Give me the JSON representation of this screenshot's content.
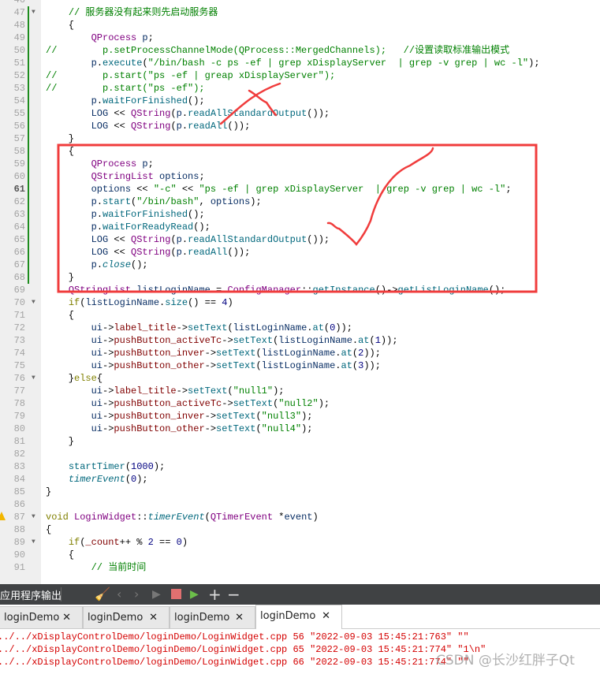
{
  "editor": {
    "current_line": "61",
    "lines": [
      {
        "n": "46",
        "tokens": []
      },
      {
        "n": "47",
        "fold": true,
        "bar": true,
        "tokens": [
          [
            "    ",
            "p"
          ],
          [
            "// 服务器没有起来则先启动服务器",
            "c"
          ]
        ]
      },
      {
        "n": "48",
        "bar": true,
        "tokens": [
          [
            "    {",
            "p"
          ]
        ]
      },
      {
        "n": "49",
        "bar": true,
        "tokens": [
          [
            "        ",
            "p"
          ],
          [
            "QProcess",
            "t"
          ],
          [
            " p",
            "v"
          ],
          [
            ";",
            "p"
          ]
        ]
      },
      {
        "n": "50",
        "bar": true,
        "tokens": [
          [
            "//        p.setProcessChannelMode(QProcess::MergedChannels);   //设置读取标准输出模式",
            "c"
          ]
        ]
      },
      {
        "n": "51",
        "bar": true,
        "tokens": [
          [
            "        p",
            "v"
          ],
          [
            ".",
            "p"
          ],
          [
            "execute",
            "f"
          ],
          [
            "(",
            "p"
          ],
          [
            "\"/bin/bash -c ps -ef | grep xDisplayServer  | grep -v grep | wc -l\"",
            "s"
          ],
          [
            ");",
            "p"
          ]
        ]
      },
      {
        "n": "52",
        "bar": true,
        "tokens": [
          [
            "//        p.start(\"ps -ef | greap xDisplayServer\");",
            "c"
          ]
        ]
      },
      {
        "n": "53",
        "bar": true,
        "tokens": [
          [
            "//        p.start(\"ps -ef\");",
            "c"
          ]
        ]
      },
      {
        "n": "54",
        "bar": true,
        "tokens": [
          [
            "        p",
            "v"
          ],
          [
            ".",
            "p"
          ],
          [
            "waitForFinished",
            "f"
          ],
          [
            "();",
            "p"
          ]
        ]
      },
      {
        "n": "55",
        "bar": true,
        "tokens": [
          [
            "        LOG",
            "v"
          ],
          [
            " << ",
            "p"
          ],
          [
            "QString",
            "t"
          ],
          [
            "(",
            "p"
          ],
          [
            "p",
            "v"
          ],
          [
            ".",
            "p"
          ],
          [
            "readAllStandardOutput",
            "f"
          ],
          [
            "());",
            "p"
          ]
        ]
      },
      {
        "n": "56",
        "bar": true,
        "tokens": [
          [
            "        LOG",
            "v"
          ],
          [
            " << ",
            "p"
          ],
          [
            "QString",
            "t"
          ],
          [
            "(",
            "p"
          ],
          [
            "p",
            "v"
          ],
          [
            ".",
            "p"
          ],
          [
            "readAll",
            "f"
          ],
          [
            "());",
            "p"
          ]
        ]
      },
      {
        "n": "57",
        "bar": true,
        "tokens": [
          [
            "    }",
            "p"
          ]
        ]
      },
      {
        "n": "58",
        "bar": true,
        "tokens": [
          [
            "    {",
            "p"
          ]
        ]
      },
      {
        "n": "59",
        "bar": true,
        "tokens": [
          [
            "        ",
            "p"
          ],
          [
            "QProcess",
            "t"
          ],
          [
            " p",
            "v"
          ],
          [
            ";",
            "p"
          ]
        ]
      },
      {
        "n": "60",
        "bar": true,
        "tokens": [
          [
            "        ",
            "p"
          ],
          [
            "QStringList",
            "t"
          ],
          [
            " options",
            "v"
          ],
          [
            ";",
            "p"
          ]
        ]
      },
      {
        "n": "61",
        "bar": true,
        "tokens": [
          [
            "        options",
            "v"
          ],
          [
            " << ",
            "p"
          ],
          [
            "\"-c\"",
            "s"
          ],
          [
            " << ",
            "p"
          ],
          [
            "\"ps -ef | grep xDisplayServer  | grep -v grep | wc -l\"",
            "s"
          ],
          [
            ";",
            "p"
          ]
        ]
      },
      {
        "n": "62",
        "bar": true,
        "tokens": [
          [
            "        p",
            "v"
          ],
          [
            ".",
            "p"
          ],
          [
            "start",
            "f"
          ],
          [
            "(",
            "p"
          ],
          [
            "\"/bin/bash\"",
            "s"
          ],
          [
            ", ",
            "p"
          ],
          [
            "options",
            "v"
          ],
          [
            ");",
            "p"
          ]
        ]
      },
      {
        "n": "63",
        "bar": true,
        "tokens": [
          [
            "        p",
            "v"
          ],
          [
            ".",
            "p"
          ],
          [
            "waitForFinished",
            "f"
          ],
          [
            "();",
            "p"
          ]
        ]
      },
      {
        "n": "64",
        "bar": true,
        "tokens": [
          [
            "        p",
            "v"
          ],
          [
            ".",
            "p"
          ],
          [
            "waitForReadyRead",
            "f"
          ],
          [
            "();",
            "p"
          ]
        ]
      },
      {
        "n": "65",
        "bar": true,
        "tokens": [
          [
            "        LOG",
            "v"
          ],
          [
            " << ",
            "p"
          ],
          [
            "QString",
            "t"
          ],
          [
            "(",
            "p"
          ],
          [
            "p",
            "v"
          ],
          [
            ".",
            "p"
          ],
          [
            "readAllStandardOutput",
            "f"
          ],
          [
            "());",
            "p"
          ]
        ]
      },
      {
        "n": "66",
        "bar": true,
        "tokens": [
          [
            "        LOG",
            "v"
          ],
          [
            " << ",
            "p"
          ],
          [
            "QString",
            "t"
          ],
          [
            "(",
            "p"
          ],
          [
            "p",
            "v"
          ],
          [
            ".",
            "p"
          ],
          [
            "readAll",
            "f"
          ],
          [
            "());",
            "p"
          ]
        ]
      },
      {
        "n": "67",
        "bar": true,
        "tokens": [
          [
            "        p",
            "v"
          ],
          [
            ".",
            "p"
          ],
          [
            "close",
            "i"
          ],
          [
            "();",
            "p"
          ]
        ]
      },
      {
        "n": "68",
        "bar": true,
        "tokens": [
          [
            "    }",
            "p"
          ]
        ]
      },
      {
        "n": "69",
        "tokens": [
          [
            "    ",
            "p"
          ],
          [
            "QStringList",
            "t"
          ],
          [
            " listLoginName",
            "v"
          ],
          [
            " = ",
            "p"
          ],
          [
            "ConfigManager",
            "t"
          ],
          [
            "::",
            "p"
          ],
          [
            "getInstance",
            "f"
          ],
          [
            "()->",
            "p"
          ],
          [
            "getListLoginName",
            "f"
          ],
          [
            "();",
            "p"
          ]
        ]
      },
      {
        "n": "70",
        "fold": true,
        "tokens": [
          [
            "    ",
            "p"
          ],
          [
            "if",
            "k"
          ],
          [
            "(",
            "p"
          ],
          [
            "listLoginName",
            "v"
          ],
          [
            ".",
            "p"
          ],
          [
            "size",
            "f"
          ],
          [
            "() == ",
            "p"
          ],
          [
            "4",
            "n"
          ],
          [
            ")",
            "p"
          ]
        ]
      },
      {
        "n": "71",
        "tokens": [
          [
            "    {",
            "p"
          ]
        ]
      },
      {
        "n": "72",
        "tokens": [
          [
            "        ui",
            "v"
          ],
          [
            "->",
            "p"
          ],
          [
            "label_title",
            "m"
          ],
          [
            "->",
            "p"
          ],
          [
            "setText",
            "f"
          ],
          [
            "(",
            "p"
          ],
          [
            "listLoginName",
            "v"
          ],
          [
            ".",
            "p"
          ],
          [
            "at",
            "f"
          ],
          [
            "(",
            "p"
          ],
          [
            "0",
            "n"
          ],
          [
            "));",
            "p"
          ]
        ]
      },
      {
        "n": "73",
        "tokens": [
          [
            "        ui",
            "v"
          ],
          [
            "->",
            "p"
          ],
          [
            "pushButton_activeTc",
            "m"
          ],
          [
            "->",
            "p"
          ],
          [
            "setText",
            "f"
          ],
          [
            "(",
            "p"
          ],
          [
            "listLoginName",
            "v"
          ],
          [
            ".",
            "p"
          ],
          [
            "at",
            "f"
          ],
          [
            "(",
            "p"
          ],
          [
            "1",
            "n"
          ],
          [
            "));",
            "p"
          ]
        ]
      },
      {
        "n": "74",
        "tokens": [
          [
            "        ui",
            "v"
          ],
          [
            "->",
            "p"
          ],
          [
            "pushButton_inver",
            "m"
          ],
          [
            "->",
            "p"
          ],
          [
            "setText",
            "f"
          ],
          [
            "(",
            "p"
          ],
          [
            "listLoginName",
            "v"
          ],
          [
            ".",
            "p"
          ],
          [
            "at",
            "f"
          ],
          [
            "(",
            "p"
          ],
          [
            "2",
            "n"
          ],
          [
            "));",
            "p"
          ]
        ]
      },
      {
        "n": "75",
        "tokens": [
          [
            "        ui",
            "v"
          ],
          [
            "->",
            "p"
          ],
          [
            "pushButton_other",
            "m"
          ],
          [
            "->",
            "p"
          ],
          [
            "setText",
            "f"
          ],
          [
            "(",
            "p"
          ],
          [
            "listLoginName",
            "v"
          ],
          [
            ".",
            "p"
          ],
          [
            "at",
            "f"
          ],
          [
            "(",
            "p"
          ],
          [
            "3",
            "n"
          ],
          [
            "));",
            "p"
          ]
        ]
      },
      {
        "n": "76",
        "fold": true,
        "tokens": [
          [
            "    }",
            "p"
          ],
          [
            "else",
            "k"
          ],
          [
            "{",
            "p"
          ]
        ]
      },
      {
        "n": "77",
        "tokens": [
          [
            "        ui",
            "v"
          ],
          [
            "->",
            "p"
          ],
          [
            "label_title",
            "m"
          ],
          [
            "->",
            "p"
          ],
          [
            "setText",
            "f"
          ],
          [
            "(",
            "p"
          ],
          [
            "\"null1\"",
            "s"
          ],
          [
            ");",
            "p"
          ]
        ]
      },
      {
        "n": "78",
        "tokens": [
          [
            "        ui",
            "v"
          ],
          [
            "->",
            "p"
          ],
          [
            "pushButton_activeTc",
            "m"
          ],
          [
            "->",
            "p"
          ],
          [
            "setText",
            "f"
          ],
          [
            "(",
            "p"
          ],
          [
            "\"null2\"",
            "s"
          ],
          [
            ");",
            "p"
          ]
        ]
      },
      {
        "n": "79",
        "tokens": [
          [
            "        ui",
            "v"
          ],
          [
            "->",
            "p"
          ],
          [
            "pushButton_inver",
            "m"
          ],
          [
            "->",
            "p"
          ],
          [
            "setText",
            "f"
          ],
          [
            "(",
            "p"
          ],
          [
            "\"null3\"",
            "s"
          ],
          [
            ");",
            "p"
          ]
        ]
      },
      {
        "n": "80",
        "tokens": [
          [
            "        ui",
            "v"
          ],
          [
            "->",
            "p"
          ],
          [
            "pushButton_other",
            "m"
          ],
          [
            "->",
            "p"
          ],
          [
            "setText",
            "f"
          ],
          [
            "(",
            "p"
          ],
          [
            "\"null4\"",
            "s"
          ],
          [
            ");",
            "p"
          ]
        ]
      },
      {
        "n": "81",
        "tokens": [
          [
            "    }",
            "p"
          ]
        ]
      },
      {
        "n": "82",
        "tokens": []
      },
      {
        "n": "83",
        "tokens": [
          [
            "    ",
            "p"
          ],
          [
            "startTimer",
            "f"
          ],
          [
            "(",
            "p"
          ],
          [
            "1000",
            "n"
          ],
          [
            ");",
            "p"
          ]
        ]
      },
      {
        "n": "84",
        "tokens": [
          [
            "    ",
            "p"
          ],
          [
            "timerEvent",
            "i"
          ],
          [
            "(",
            "p"
          ],
          [
            "0",
            "n"
          ],
          [
            ");",
            "p"
          ]
        ]
      },
      {
        "n": "85",
        "tokens": [
          [
            "}",
            "p"
          ]
        ]
      },
      {
        "n": "86",
        "tokens": []
      },
      {
        "n": "87",
        "fold": true,
        "warn": true,
        "tokens": [
          [
            "void",
            "k"
          ],
          [
            " ",
            "p"
          ],
          [
            "LoginWidget",
            "t"
          ],
          [
            "::",
            "p"
          ],
          [
            "timerEvent",
            "i"
          ],
          [
            "(",
            "p"
          ],
          [
            "QTimerEvent",
            "t"
          ],
          [
            " *",
            "p"
          ],
          [
            "event",
            "v"
          ],
          [
            ")",
            "p"
          ]
        ]
      },
      {
        "n": "88",
        "tokens": [
          [
            "{",
            "p"
          ]
        ]
      },
      {
        "n": "89",
        "fold": true,
        "tokens": [
          [
            "    ",
            "p"
          ],
          [
            "if",
            "k"
          ],
          [
            "(",
            "p"
          ],
          [
            "_count",
            "m"
          ],
          [
            "++ % ",
            "p"
          ],
          [
            "2",
            "n"
          ],
          [
            " == ",
            "p"
          ],
          [
            "0",
            "n"
          ],
          [
            ")",
            "p"
          ]
        ]
      },
      {
        "n": "90",
        "tokens": [
          [
            "    {",
            "p"
          ]
        ]
      },
      {
        "n": "91",
        "tokens": [
          [
            "        ",
            "p"
          ],
          [
            "// 当前时间",
            "c"
          ]
        ]
      }
    ]
  },
  "annotation_color": "#f03c3c",
  "output_panel": {
    "title": "应用程序输出",
    "toolbar_icons": [
      "clear-icon",
      "chevron-left-icon",
      "chevron-right-icon",
      "run-icon",
      "stop-icon",
      "debug-run-icon",
      "plus-icon",
      "minus-icon"
    ],
    "tabs": [
      {
        "label": "loginDemo",
        "close": "✕"
      },
      {
        "label": "loginDemo",
        "close": "✕"
      },
      {
        "label": "loginDemo",
        "close": "✕"
      },
      {
        "label": "loginDemo",
        "close": "✕",
        "active": true
      }
    ],
    "output_lines": [
      "../../xDisplayControlDemo/loginDemo/LoginWidget.cpp 56 \"2022-09-03 15:45:21:763\" \"\"",
      "../../xDisplayControlDemo/loginDemo/LoginWidget.cpp 65 \"2022-09-03 15:45:21:774\" \"1\\n\"",
      "../../xDisplayControlDemo/loginDemo/LoginWidget.cpp 66 \"2022-09-03 15:45:21:774\" \"\""
    ],
    "output_color": "#d40000"
  },
  "watermark": "CSDN @长沙红胖子Qt"
}
